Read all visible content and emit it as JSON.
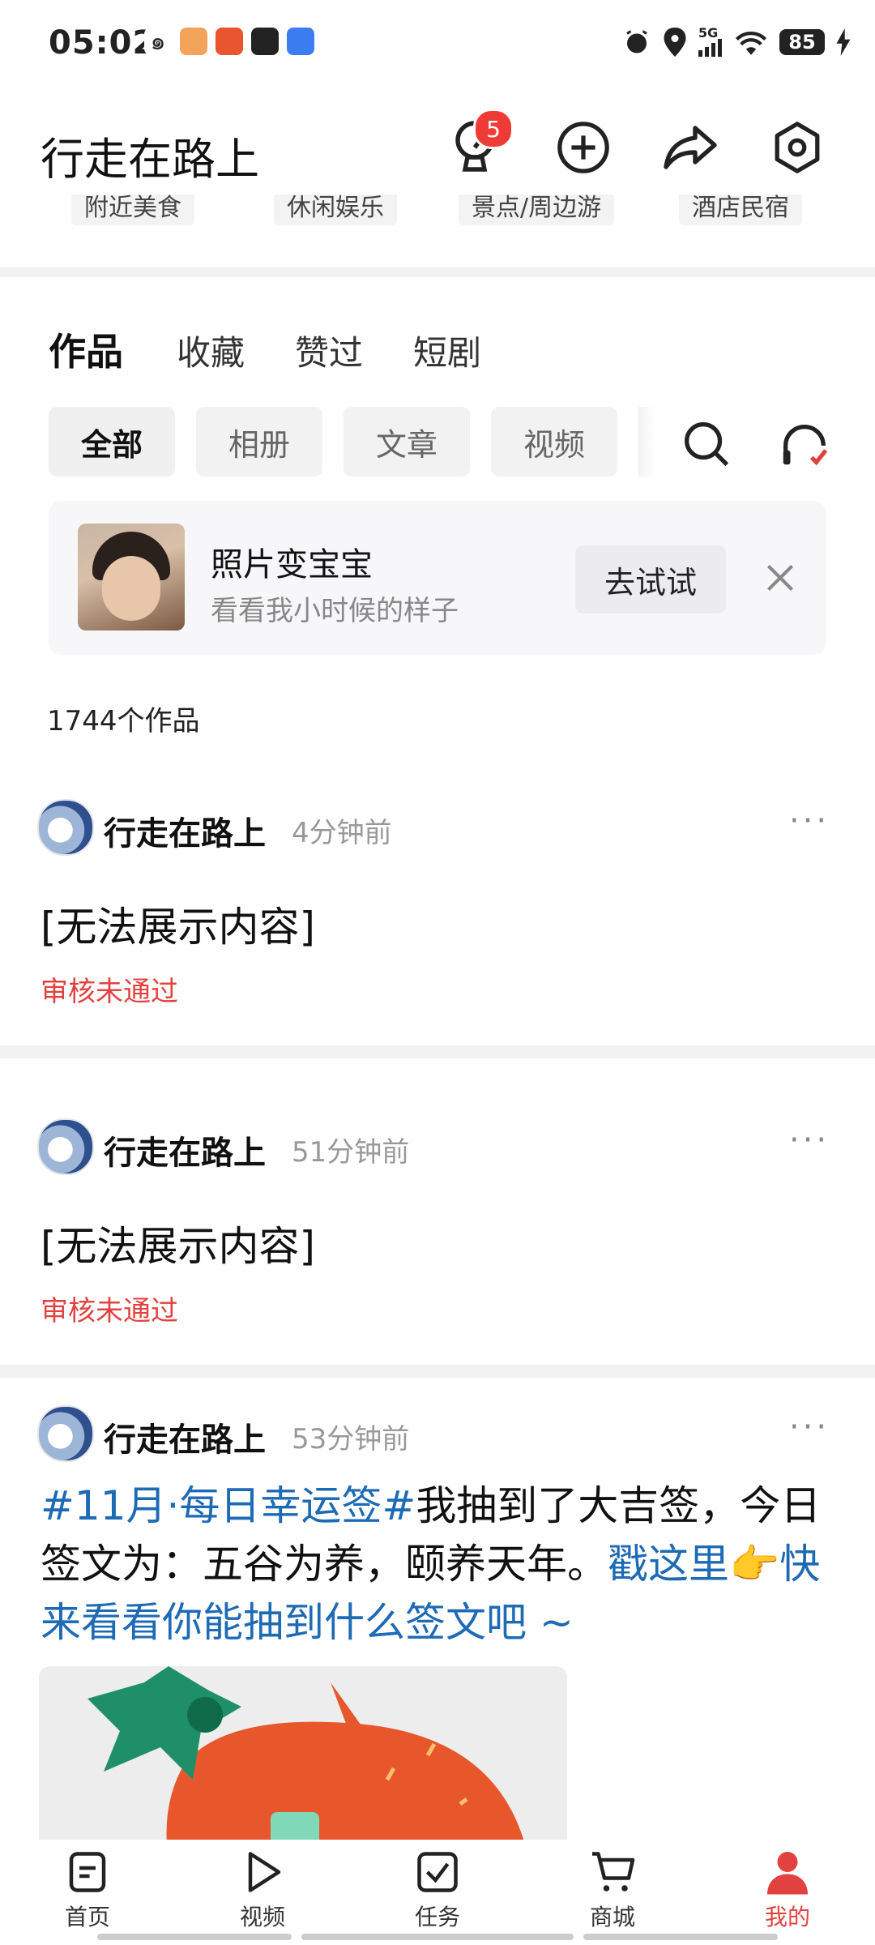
{
  "status": {
    "time": "05:02",
    "network": "5G",
    "battery": "85"
  },
  "header": {
    "title": "行走在路上",
    "notification_count": "5"
  },
  "categories": [
    "附近美食",
    "休闲娱乐",
    "景点/周边游",
    "酒店民宿"
  ],
  "tabs": [
    "作品",
    "收藏",
    "赞过",
    "短剧"
  ],
  "filters": [
    "全部",
    "相册",
    "文章",
    "视频"
  ],
  "promo": {
    "title": "照片变宝宝",
    "subtitle": "看看我小时候的样子",
    "button": "去试试"
  },
  "works_count": "1744个作品",
  "posts": [
    {
      "author": "行走在路上",
      "time": "4分钟前",
      "content": "[无法展示内容]",
      "status": "审核未通过"
    },
    {
      "author": "行走在路上",
      "time": "51分钟前",
      "content": "[无法展示内容]",
      "status": "审核未通过"
    },
    {
      "author": "行走在路上",
      "time": "53分钟前",
      "hashtag": "#11月·每日幸运签#",
      "text": "我抽到了大吉签，今日签文为：五谷为养，颐养天年。",
      "link": "戳这里👉快来看看你能抽到什么签文吧 ~"
    }
  ],
  "nav": [
    "首页",
    "视频",
    "任务",
    "商城",
    "我的"
  ],
  "colors": {
    "accent": "#e2423f",
    "link": "#1d6ab5"
  }
}
